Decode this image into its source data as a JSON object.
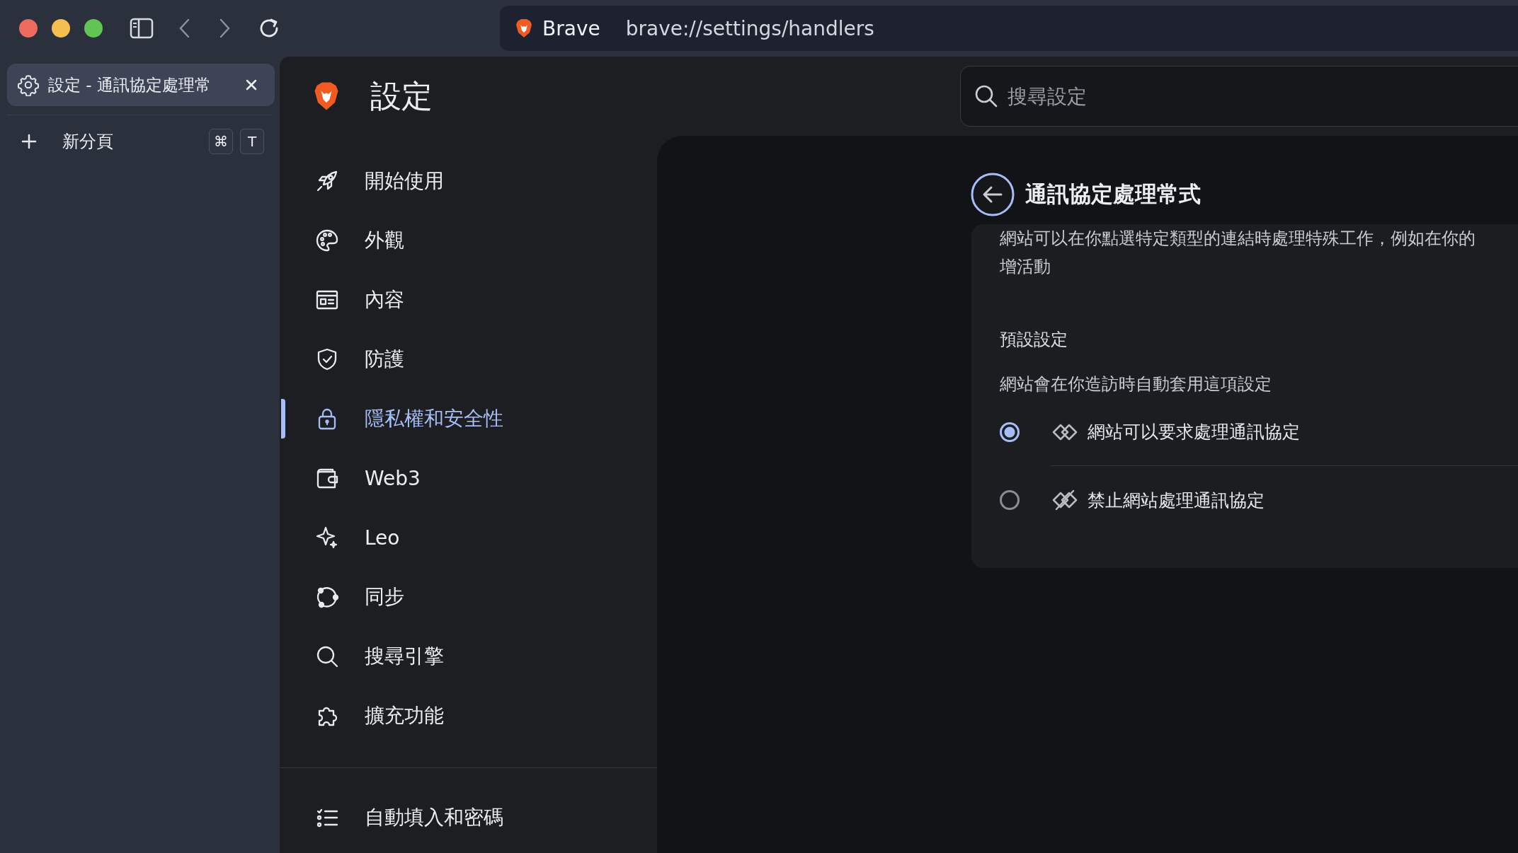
{
  "address_bar": {
    "site": "Brave",
    "url": "brave://settings/handlers"
  },
  "tabs": [
    {
      "title": "設定 - 通訊協定處理常",
      "selected": true
    }
  ],
  "new_tab": {
    "label": "新分頁",
    "keys": [
      "⌘",
      "T"
    ]
  },
  "settings": {
    "title": "設定",
    "search": {
      "placeholder": "搜尋設定"
    },
    "nav": [
      {
        "label": "開始使用",
        "selected": false
      },
      {
        "label": "外觀",
        "selected": false
      },
      {
        "label": "內容",
        "selected": false
      },
      {
        "label": "防護",
        "selected": false
      },
      {
        "label": "隱私權和安全性",
        "selected": true
      },
      {
        "label": "Web3",
        "selected": false
      },
      {
        "label": "Leo",
        "selected": false
      },
      {
        "label": "同步",
        "selected": false
      },
      {
        "label": "搜尋引擎",
        "selected": false
      },
      {
        "label": "擴充功能",
        "selected": false
      }
    ],
    "nav_bottom": [
      {
        "label": "自動填入和密碼",
        "selected": false
      }
    ]
  },
  "page": {
    "title": "通訊協定處理常式",
    "description_lines": [
      "網站可以在你點選特定類型的連結時處理特殊工作，例如在你的",
      "增活動"
    ],
    "section_title": "預設設定",
    "section_subtitle": "網站會在你造訪時自動套用這項設定",
    "options": [
      {
        "label": "網站可以要求處理通訊協定",
        "selected": true
      },
      {
        "label": "禁止網站處理通訊協定",
        "selected": false
      }
    ]
  }
}
